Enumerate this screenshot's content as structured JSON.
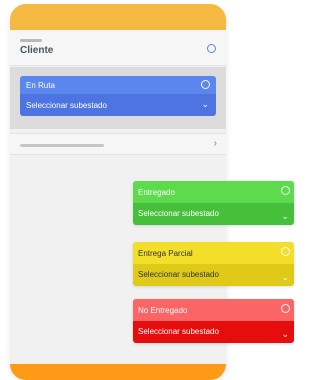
{
  "header": {
    "title": "Cliente",
    "radio_icon": "radio-circle-icon"
  },
  "status_card": {
    "label": "En Ruta",
    "substatus_placeholder": "Seleccionar subestado",
    "color": "#5a86ee"
  },
  "list_row": {
    "chevron_icon": "chevron-right-icon"
  },
  "options": [
    {
      "label": "Entregado",
      "substatus_placeholder": "Seleccionar subestado",
      "color": "#5ddb4c"
    },
    {
      "label": "Entrega Parcial",
      "substatus_placeholder": "Seleccionar subestado",
      "color": "#f3df2a"
    },
    {
      "label": "No Entregado",
      "substatus_placeholder": "Seleccionar subestado",
      "color": "#fb6565"
    }
  ],
  "icons": {
    "radio": "radio-circle-icon",
    "dropdown": "chevron-down-icon"
  },
  "colors": {
    "top_bar": "#f5b942",
    "bottom_bar": "#ff9a17",
    "accent": "#5f84ea"
  }
}
